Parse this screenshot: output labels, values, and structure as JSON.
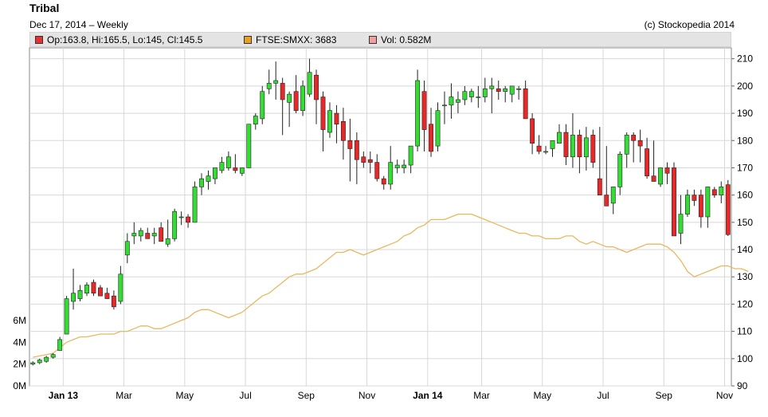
{
  "header": {
    "title": "Tribal",
    "subtitle": "Dec 17, 2014 – Weekly",
    "copyright": "(c) Stockopedia 2014"
  },
  "legend": [
    {
      "label": "Op:163.8, Hi:165.5, Lo:145, Cl:145.5",
      "color": "#e83030"
    },
    {
      "label": "FTSE:SMXX: 3683",
      "color": "#e8a020"
    },
    {
      "label": "Vol: 0.582M",
      "color": "#f0a0a0"
    }
  ],
  "colors": {
    "up": "#33dd33",
    "down": "#e82828",
    "line": "#e8b860",
    "vol_up": "#a8f0a0",
    "vol_down": "#f4a8a8",
    "grid": "#d8d8d8"
  },
  "chart_data": {
    "type": "candlestick",
    "title": "Tribal",
    "x_tick_labels": [
      "Jan 13",
      "Mar",
      "May",
      "Jul",
      "Sep",
      "Nov",
      "Jan 14",
      "Mar",
      "May",
      "Jul",
      "Sep",
      "Nov"
    ],
    "x_tick_weeks": [
      5,
      14,
      23,
      32,
      41,
      50,
      59,
      67,
      76,
      85,
      94,
      103
    ],
    "y_ticks": [
      90,
      100,
      110,
      120,
      130,
      140,
      150,
      160,
      170,
      180,
      190,
      200,
      210
    ],
    "ylim": [
      90,
      214
    ],
    "vol_ticks": [
      {
        "value": 0,
        "label": "0M"
      },
      {
        "value": 2,
        "label": "2M"
      },
      {
        "value": 4,
        "label": "4M"
      },
      {
        "value": 6,
        "label": "6M"
      }
    ],
    "vol_ylim": [
      0,
      6
    ],
    "ohlc": [
      [
        98,
        99,
        97.5,
        98.5
      ],
      [
        98.5,
        100,
        98,
        99.5
      ],
      [
        99,
        101,
        98.5,
        100.5
      ],
      [
        100.5,
        102,
        100,
        101.5
      ],
      [
        103,
        108,
        103,
        107
      ],
      [
        109,
        123,
        109,
        122
      ],
      [
        121,
        133,
        118,
        124
      ],
      [
        122,
        127,
        121,
        125
      ],
      [
        124,
        128,
        123,
        127
      ],
      [
        128,
        129,
        123,
        124
      ],
      [
        126,
        127,
        124,
        123
      ],
      [
        124,
        126,
        122,
        122
      ],
      [
        123,
        125,
        118,
        119
      ],
      [
        121,
        134,
        120,
        131
      ],
      [
        138,
        146,
        135,
        143
      ],
      [
        145,
        150,
        142,
        146
      ],
      [
        145,
        148,
        143,
        147
      ],
      [
        146,
        148,
        144,
        144
      ],
      [
        145,
        148,
        142,
        146
      ],
      [
        148,
        150,
        143,
        143
      ],
      [
        142,
        151,
        141,
        144
      ],
      [
        144,
        155,
        143,
        154
      ],
      [
        152,
        154,
        149,
        152
      ],
      [
        152,
        153,
        148,
        150
      ],
      [
        150,
        165,
        150,
        163
      ],
      [
        163,
        168,
        160,
        166
      ],
      [
        165,
        169,
        162,
        167
      ],
      [
        166,
        170,
        164,
        170
      ],
      [
        169,
        174,
        168,
        172
      ],
      [
        170,
        176,
        169,
        174
      ],
      [
        170,
        175,
        168,
        169
      ],
      [
        168,
        170,
        167,
        170
      ],
      [
        170,
        185,
        170,
        186
      ],
      [
        186,
        190,
        184,
        189
      ],
      [
        188,
        200,
        186,
        198
      ],
      [
        199,
        206,
        197,
        201
      ],
      [
        201,
        209,
        195,
        202
      ],
      [
        201,
        203,
        182,
        195
      ],
      [
        194,
        198,
        185,
        197
      ],
      [
        198,
        204,
        190,
        191
      ],
      [
        191,
        202,
        189,
        200
      ],
      [
        197,
        210,
        196,
        205
      ],
      [
        204,
        206,
        186,
        195
      ],
      [
        196,
        198,
        176,
        184
      ],
      [
        183,
        194,
        181,
        191
      ],
      [
        190,
        193,
        179,
        186
      ],
      [
        187,
        192,
        173,
        180
      ],
      [
        180,
        188,
        165,
        177
      ],
      [
        180,
        183,
        164,
        173
      ],
      [
        174,
        176,
        170,
        172
      ],
      [
        173,
        176,
        168,
        172
      ],
      [
        172,
        175,
        165,
        166
      ],
      [
        166,
        167,
        162,
        164
      ],
      [
        164,
        178,
        162,
        172
      ],
      [
        170,
        173,
        168,
        171
      ],
      [
        170,
        173,
        168,
        171
      ],
      [
        171,
        176,
        168,
        178
      ],
      [
        178,
        206,
        176,
        202
      ],
      [
        198,
        202,
        176,
        184
      ],
      [
        186,
        192,
        174,
        176
      ],
      [
        178,
        194,
        176,
        191
      ],
      [
        193,
        198,
        186,
        193
      ],
      [
        193,
        201,
        188,
        196
      ],
      [
        194,
        198,
        190,
        195
      ],
      [
        195,
        200,
        193,
        198
      ],
      [
        196,
        199,
        194,
        198
      ],
      [
        196,
        200,
        192,
        196
      ],
      [
        196,
        203,
        194,
        199
      ],
      [
        199,
        203,
        190,
        200
      ],
      [
        199,
        202,
        195,
        198
      ],
      [
        198,
        200,
        194,
        199
      ],
      [
        197,
        198,
        194,
        200
      ],
      [
        199,
        200,
        195,
        199
      ],
      [
        199,
        202,
        193,
        188
      ],
      [
        188,
        190,
        175,
        179
      ],
      [
        178,
        182,
        175,
        176
      ],
      [
        176,
        178,
        175,
        176
      ],
      [
        177,
        180,
        174,
        180
      ],
      [
        179,
        186,
        179,
        183
      ],
      [
        183,
        186,
        171,
        174
      ],
      [
        174,
        190,
        170,
        182
      ],
      [
        182,
        184,
        168,
        174
      ],
      [
        174,
        185,
        169,
        181
      ],
      [
        182,
        184,
        170,
        172
      ],
      [
        166,
        185,
        164,
        160
      ],
      [
        160,
        178,
        156,
        156
      ],
      [
        157,
        158,
        153,
        163
      ],
      [
        163,
        176,
        160,
        175
      ],
      [
        175,
        183,
        170,
        182
      ],
      [
        182,
        183,
        172,
        180
      ],
      [
        180,
        184,
        172,
        178
      ],
      [
        177,
        181,
        166,
        167
      ],
      [
        167,
        180,
        165,
        165
      ],
      [
        164,
        170,
        163,
        170
      ],
      [
        170,
        172,
        164,
        168
      ],
      [
        170,
        172,
        150,
        145
      ],
      [
        146,
        160,
        142,
        153
      ],
      [
        153,
        162,
        152,
        160
      ],
      [
        160,
        162,
        156,
        158
      ],
      [
        160,
        162,
        148,
        152
      ],
      [
        152,
        162,
        148,
        163
      ],
      [
        162,
        163,
        159,
        160
      ],
      [
        160,
        165,
        157,
        163
      ],
      [
        163.8,
        165.5,
        145,
        145.5
      ]
    ],
    "ftse_smxx": [
      100.5,
      101,
      101.5,
      102,
      104,
      106,
      107,
      108,
      108,
      108.5,
      109,
      109,
      109,
      110,
      110,
      111,
      112,
      112,
      111,
      111,
      112,
      113,
      114,
      115,
      117,
      118,
      118,
      117,
      116,
      115,
      116,
      117,
      119,
      121,
      123,
      124,
      126,
      128,
      130,
      131,
      131,
      132,
      133,
      135,
      137,
      139,
      139,
      140,
      139,
      138,
      139,
      140,
      141,
      142,
      143,
      145,
      146,
      148,
      149,
      151,
      151,
      151,
      152,
      153,
      153,
      153,
      152,
      151,
      150,
      149,
      148,
      147,
      146,
      146,
      145,
      145,
      144,
      144,
      144,
      145,
      145,
      143,
      142,
      143,
      142,
      141,
      141,
      140,
      139,
      140,
      141,
      142,
      142,
      142,
      141,
      139,
      136,
      132,
      130,
      131,
      132,
      133,
      134,
      134,
      133,
      133,
      132
    ]
  }
}
